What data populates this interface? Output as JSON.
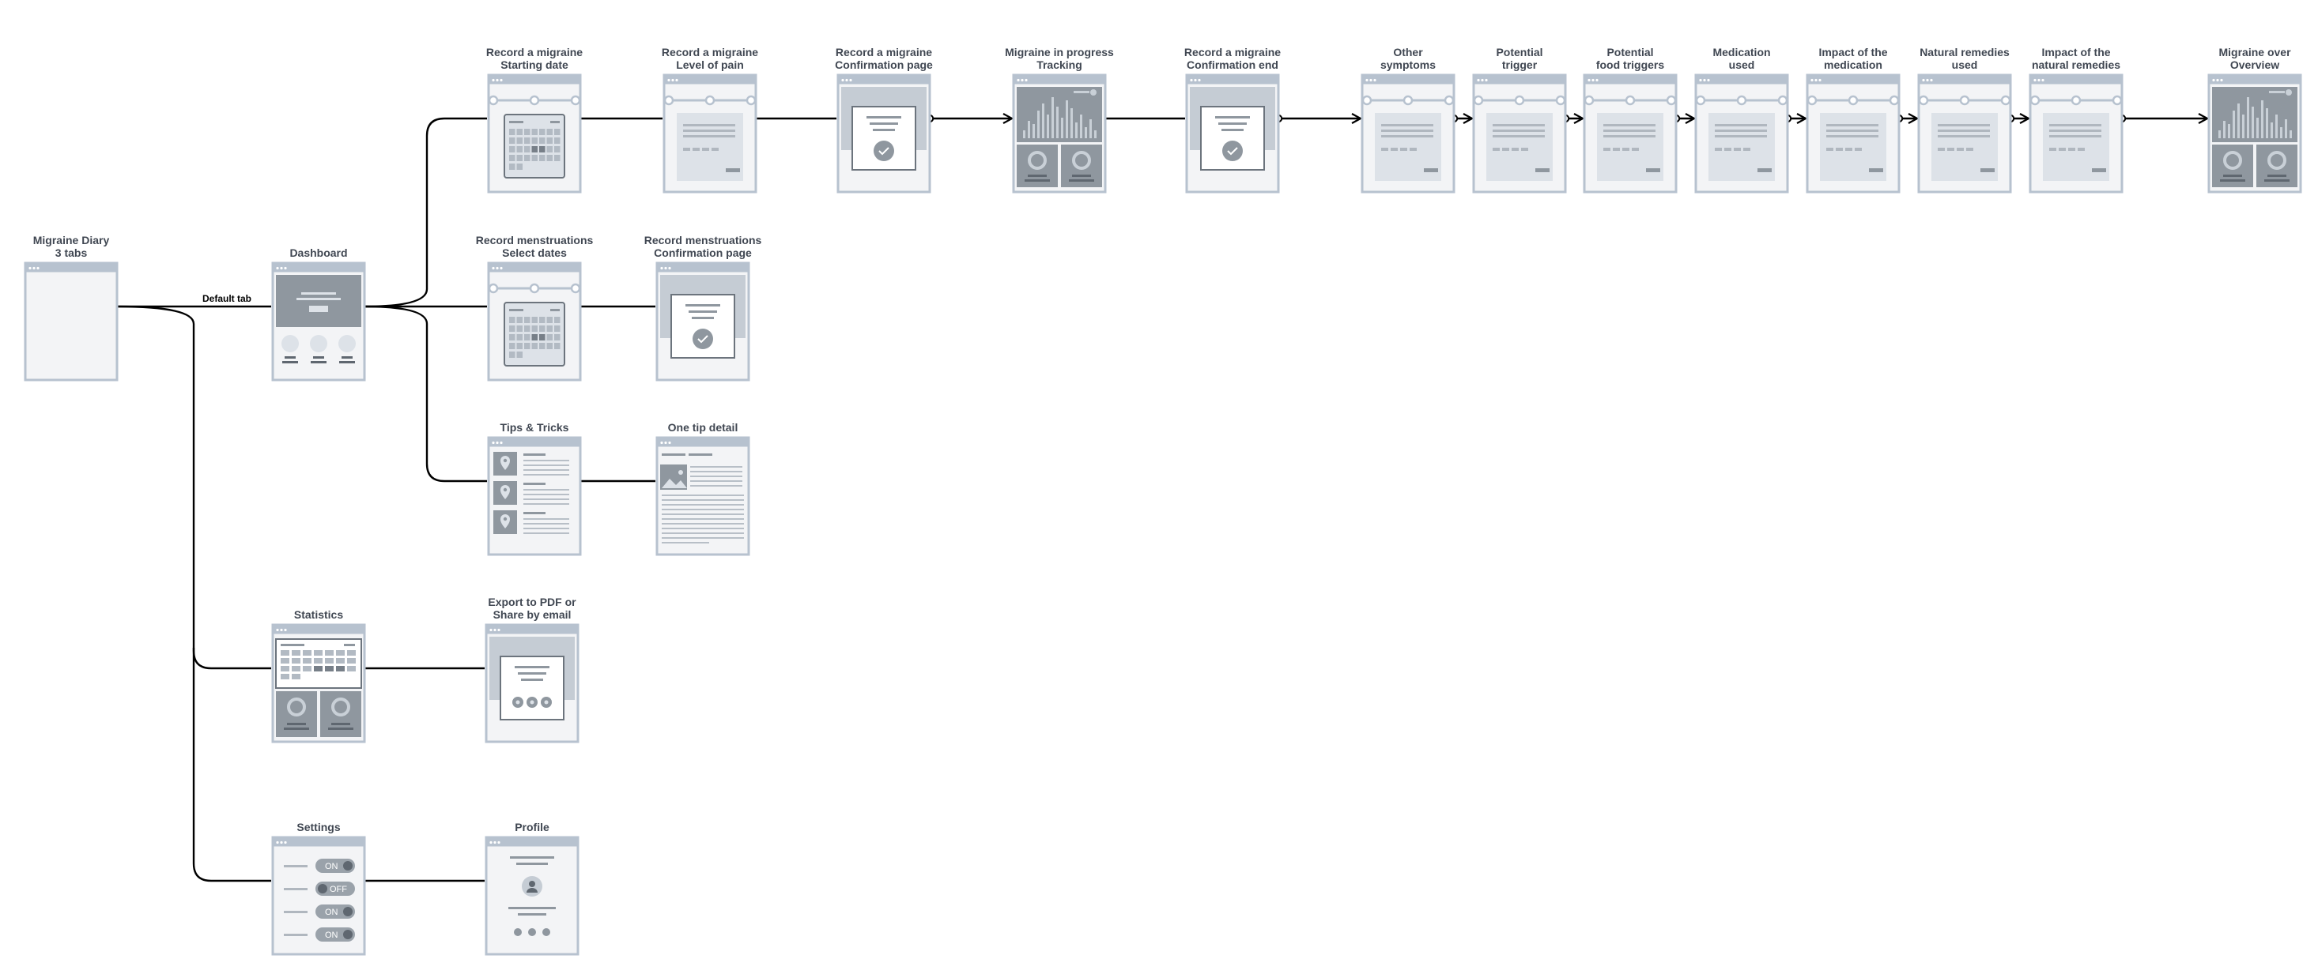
{
  "diagram": {
    "type": "user-flow wireframe",
    "colors": {
      "line": "#000000",
      "frame_border": "#b7c2cf",
      "frame_fill": "#f3f4f6",
      "content_light": "#dde2e8",
      "content_dark": "#8f979f",
      "title": "#404752"
    }
  },
  "screens": {
    "diary": [
      "Migraine Diary",
      "3 tabs"
    ],
    "dashboard": [
      "Dashboard"
    ],
    "m_start": [
      "Record a migraine",
      "Starting date"
    ],
    "m_pain": [
      "Record a migraine",
      "Level of pain"
    ],
    "m_confirm": [
      "Record a migraine",
      "Confirmation page"
    ],
    "m_progress": [
      "Migraine in progress",
      "Tracking"
    ],
    "m_end": [
      "Record a migraine",
      "Confirmation end"
    ],
    "other_symptoms": [
      "Other",
      "symptoms"
    ],
    "potential_trigger": [
      "Potential",
      "trigger"
    ],
    "food_triggers": [
      "Potential",
      "food triggers"
    ],
    "medication": [
      "Medication",
      "used"
    ],
    "impact_med": [
      "Impact of the",
      "medication"
    ],
    "natural": [
      "Natural remedies",
      "used"
    ],
    "impact_natural": [
      "Impact of the",
      "natural remedies"
    ],
    "overview": [
      "Migraine over",
      "Overview"
    ],
    "mens_select": [
      "Record menstruations",
      "Select dates"
    ],
    "mens_confirm": [
      "Record menstruations",
      "Confirmation page"
    ],
    "tips": [
      "Tips & Tricks"
    ],
    "tip_detail": [
      "One tip detail"
    ],
    "statistics": [
      "Statistics"
    ],
    "export": [
      "Export to PDF or",
      "Share by email"
    ],
    "settings": [
      "Settings"
    ],
    "profile": [
      "Profile"
    ]
  },
  "edge_labels": {
    "default_tab": "Default tab"
  },
  "toggles": [
    "ON",
    "OFF",
    "ON",
    "ON"
  ],
  "icons": {
    "check": "check-icon",
    "location": "location-pin-icon",
    "image": "image-icon",
    "avatar": "user-avatar-icon",
    "share": "share-icons"
  }
}
